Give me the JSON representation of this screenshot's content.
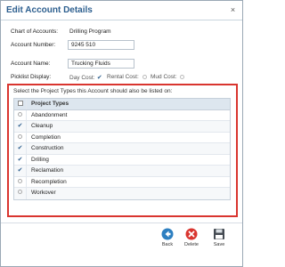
{
  "dialog": {
    "title": "Edit Account Details",
    "close_glyph": "×"
  },
  "form": {
    "chart_of_accounts_label": "Chart of Accounts:",
    "chart_of_accounts_value": "Drilling Program",
    "account_number_label": "Account Number:",
    "account_number_value": "9245 510",
    "account_name_label": "Account Name:",
    "account_name_value": "Trucking Fluids",
    "picklist_label": "Picklist Display:",
    "picklist": [
      {
        "label": "Day Cost:",
        "checked": true
      },
      {
        "label": "Rental Cost:",
        "checked": false
      },
      {
        "label": "Mud Cost:",
        "checked": false
      }
    ]
  },
  "project_types": {
    "caption": "Select the Project Types this Account should also be listed on:",
    "header": "Project Types",
    "items": [
      {
        "label": "Abandonment",
        "checked": false
      },
      {
        "label": "Cleanup",
        "checked": true
      },
      {
        "label": "Completion",
        "checked": false
      },
      {
        "label": "Construction",
        "checked": true
      },
      {
        "label": "Drilling",
        "checked": true
      },
      {
        "label": "Reclamation",
        "checked": true
      },
      {
        "label": "Recompletion",
        "checked": false
      },
      {
        "label": "Workover",
        "checked": false
      }
    ]
  },
  "buttons": {
    "back": "Back",
    "delete": "Delete",
    "save": "Save"
  },
  "colors": {
    "accent": "#2d5f8f",
    "highlight_border": "#d9352f",
    "delete_red": "#d9352f"
  },
  "icons": {
    "back": "back-arrow-icon",
    "delete": "delete-icon",
    "save": "save-disk-icon",
    "check": "checkmark-icon",
    "close": "close-icon"
  }
}
